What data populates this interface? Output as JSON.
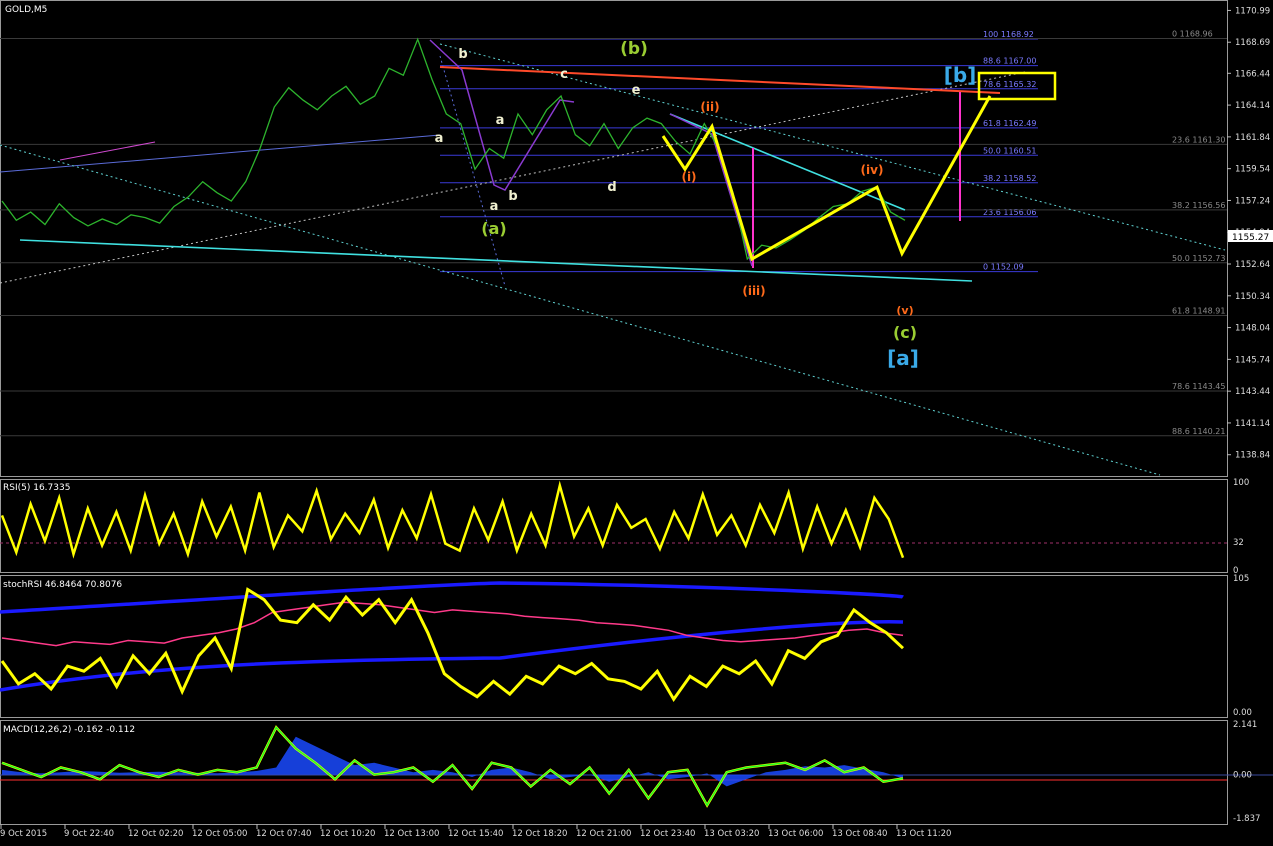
{
  "chart_data": [
    {
      "type": "line",
      "symbol": "GOLD,M5",
      "current_price": "1155.27",
      "ylim": [
        1137.3,
        1171.6
      ],
      "y_ticks": [
        "1170.99",
        "1168.69",
        "1166.44",
        "1164.14",
        "1161.84",
        "1159.54",
        "1157.24",
        "1154.94",
        "1152.64",
        "1150.34",
        "1148.04",
        "1145.74",
        "1143.44",
        "1141.14",
        "1138.84"
      ],
      "time_labels": [
        "9 Oct 2015",
        "9 Oct 22:40",
        "12 Oct 02:20",
        "12 Oct 05:00",
        "12 Oct 07:40",
        "12 Oct 10:20",
        "12 Oct 13:00",
        "12 Oct 15:40",
        "12 Oct 18:20",
        "12 Oct 21:00",
        "12 Oct 23:40",
        "13 Oct 03:20",
        "13 Oct 06:00",
        "13 Oct 08:40",
        "13 Oct 11:20"
      ],
      "price_series": [
        1157.2,
        1155.8,
        1156.4,
        1155.5,
        1157.0,
        1156.0,
        1155.4,
        1155.9,
        1155.5,
        1156.2,
        1156.0,
        1155.6,
        1156.8,
        1157.5,
        1158.6,
        1157.8,
        1157.2,
        1158.6,
        1161.0,
        1164.0,
        1165.4,
        1164.5,
        1163.8,
        1164.8,
        1165.5,
        1164.2,
        1164.8,
        1166.8,
        1166.3,
        1168.9,
        1166.0,
        1163.5,
        1162.8,
        1159.5,
        1161.0,
        1160.3,
        1163.5,
        1162.0,
        1163.8,
        1164.8,
        1162.0,
        1161.2,
        1162.8,
        1161.0,
        1162.5,
        1163.2,
        1162.8,
        1161.5,
        1160.6,
        1162.8,
        1161.0,
        1157.8,
        1153.0,
        1154.0,
        1153.8,
        1154.4,
        1155.1,
        1156.0,
        1156.8,
        1157.0,
        1157.9,
        1158.2,
        1156.4,
        1155.8
      ],
      "fib_retracements_a": [
        {
          "level": "100",
          "price": "1168.92"
        },
        {
          "level": "88.6",
          "price": "1167.00"
        },
        {
          "level": "78.6",
          "price": "1165.32"
        },
        {
          "level": "61.8",
          "price": "1162.49"
        },
        {
          "level": "50.0",
          "price": "1160.51"
        },
        {
          "level": "38.2",
          "price": "1158.52"
        },
        {
          "level": "23.6",
          "price": "1156.06"
        },
        {
          "level": "0",
          "price": "1152.09"
        }
      ],
      "fib_retracements_b": [
        {
          "level": "0",
          "price": "1168.96"
        },
        {
          "level": "23.6",
          "price": "1161.30"
        },
        {
          "level": "38.2",
          "price": "1156.56"
        },
        {
          "level": "50.0",
          "price": "1152.73"
        },
        {
          "level": "61.8",
          "price": "1148.91"
        },
        {
          "level": "78.6",
          "price": "1143.45"
        },
        {
          "level": "88.6",
          "price": "1140.21"
        }
      ],
      "wave_labels": [
        "(b)",
        "[b]",
        "b",
        "c",
        "a",
        "e",
        "a",
        "b",
        "d",
        "(a)",
        "a",
        "(i)",
        "(ii)",
        "(iii)",
        "(iv)",
        "(v)",
        "(c)",
        "[a]"
      ],
      "projection_path": [
        1161.9,
        1159.5,
        1162.6,
        1153.0,
        1158.2,
        1153.4,
        1164.8
      ]
    },
    {
      "type": "line",
      "title": "RSI(5) 16.7335",
      "ylim": [
        0,
        100
      ],
      "y_ticks": [
        "100",
        "32",
        "0"
      ],
      "level": 32,
      "values": [
        62,
        20,
        75,
        33,
        82,
        18,
        70,
        28,
        66,
        22,
        85,
        30,
        64,
        18,
        78,
        38,
        72,
        22,
        88,
        26,
        62,
        44,
        90,
        35,
        64,
        42,
        80,
        25,
        68,
        36,
        86,
        30,
        22,
        70,
        34,
        78,
        22,
        64,
        28,
        96,
        38,
        70,
        28,
        74,
        48,
        58,
        24,
        66,
        36,
        86,
        40,
        62,
        28,
        74,
        42,
        88,
        24,
        72,
        30,
        68,
        26,
        82,
        58,
        14
      ]
    },
    {
      "type": "line",
      "title": "stochRSI 46.8464 70.8076",
      "ylim": [
        0,
        105
      ],
      "y_ticks": [
        "105",
        "0.00"
      ],
      "k_values": [
        40,
        22,
        30,
        18,
        36,
        32,
        42,
        20,
        44,
        30,
        46,
        16,
        44,
        58,
        34,
        96,
        88,
        72,
        70,
        84,
        72,
        90,
        76,
        88,
        70,
        88,
        62,
        30,
        20,
        12,
        24,
        14,
        28,
        22,
        36,
        30,
        38,
        26,
        24,
        18,
        32,
        10,
        28,
        20,
        36,
        30,
        40,
        22,
        48,
        42,
        55,
        60,
        80,
        70,
        62,
        50
      ],
      "d_values": [
        58,
        56,
        54,
        52,
        55,
        54,
        53,
        56,
        55,
        54,
        58,
        60,
        62,
        65,
        70,
        78,
        80,
        82,
        84,
        86,
        85,
        84,
        82,
        80,
        78,
        80,
        79,
        78,
        77,
        75,
        74,
        73,
        72,
        70,
        69,
        68,
        66,
        64,
        60,
        58,
        56,
        55,
        56,
        57,
        58,
        60,
        62,
        64,
        65,
        62,
        60
      ]
    },
    {
      "type": "area",
      "title": "MACD(12,26,2) -0.162 -0.112",
      "ylim": [
        -1.837,
        2.141
      ],
      "y_ticks": [
        "2.141",
        "0.00",
        "-1.837"
      ],
      "signal_values": [
        0.2,
        0.1,
        0.05,
        0.1,
        0.15,
        0.12,
        0.08,
        0.1,
        0.12,
        0.1,
        0.08,
        0.06,
        0.1,
        0.15,
        0.3,
        1.6,
        1.2,
        0.8,
        0.4,
        0.5,
        0.3,
        0.1,
        0.2,
        0.1,
        -0.1,
        0.2,
        0.3,
        0.1,
        -0.2,
        -0.1,
        0.0,
        -0.3,
        -0.1,
        0.1,
        -0.2,
        -0.1,
        0.05,
        -0.5,
        -0.2,
        0.1,
        0.2,
        0.35,
        0.3,
        0.4,
        0.25,
        0.1,
        -0.16
      ],
      "main_values": [
        0.5,
        0.2,
        -0.1,
        0.3,
        0.1,
        -0.2,
        0.4,
        0.1,
        -0.1,
        0.2,
        0.0,
        0.2,
        0.1,
        0.3,
        2.0,
        1.1,
        0.5,
        -0.2,
        0.6,
        0.0,
        0.1,
        0.3,
        -0.3,
        0.4,
        -0.6,
        0.5,
        0.3,
        -0.5,
        0.2,
        -0.4,
        0.3,
        -0.8,
        0.2,
        -1.0,
        0.1,
        0.2,
        -1.3,
        0.1,
        0.3,
        0.4,
        0.5,
        0.2,
        0.6,
        0.1,
        0.3,
        -0.3,
        -0.16
      ]
    }
  ]
}
